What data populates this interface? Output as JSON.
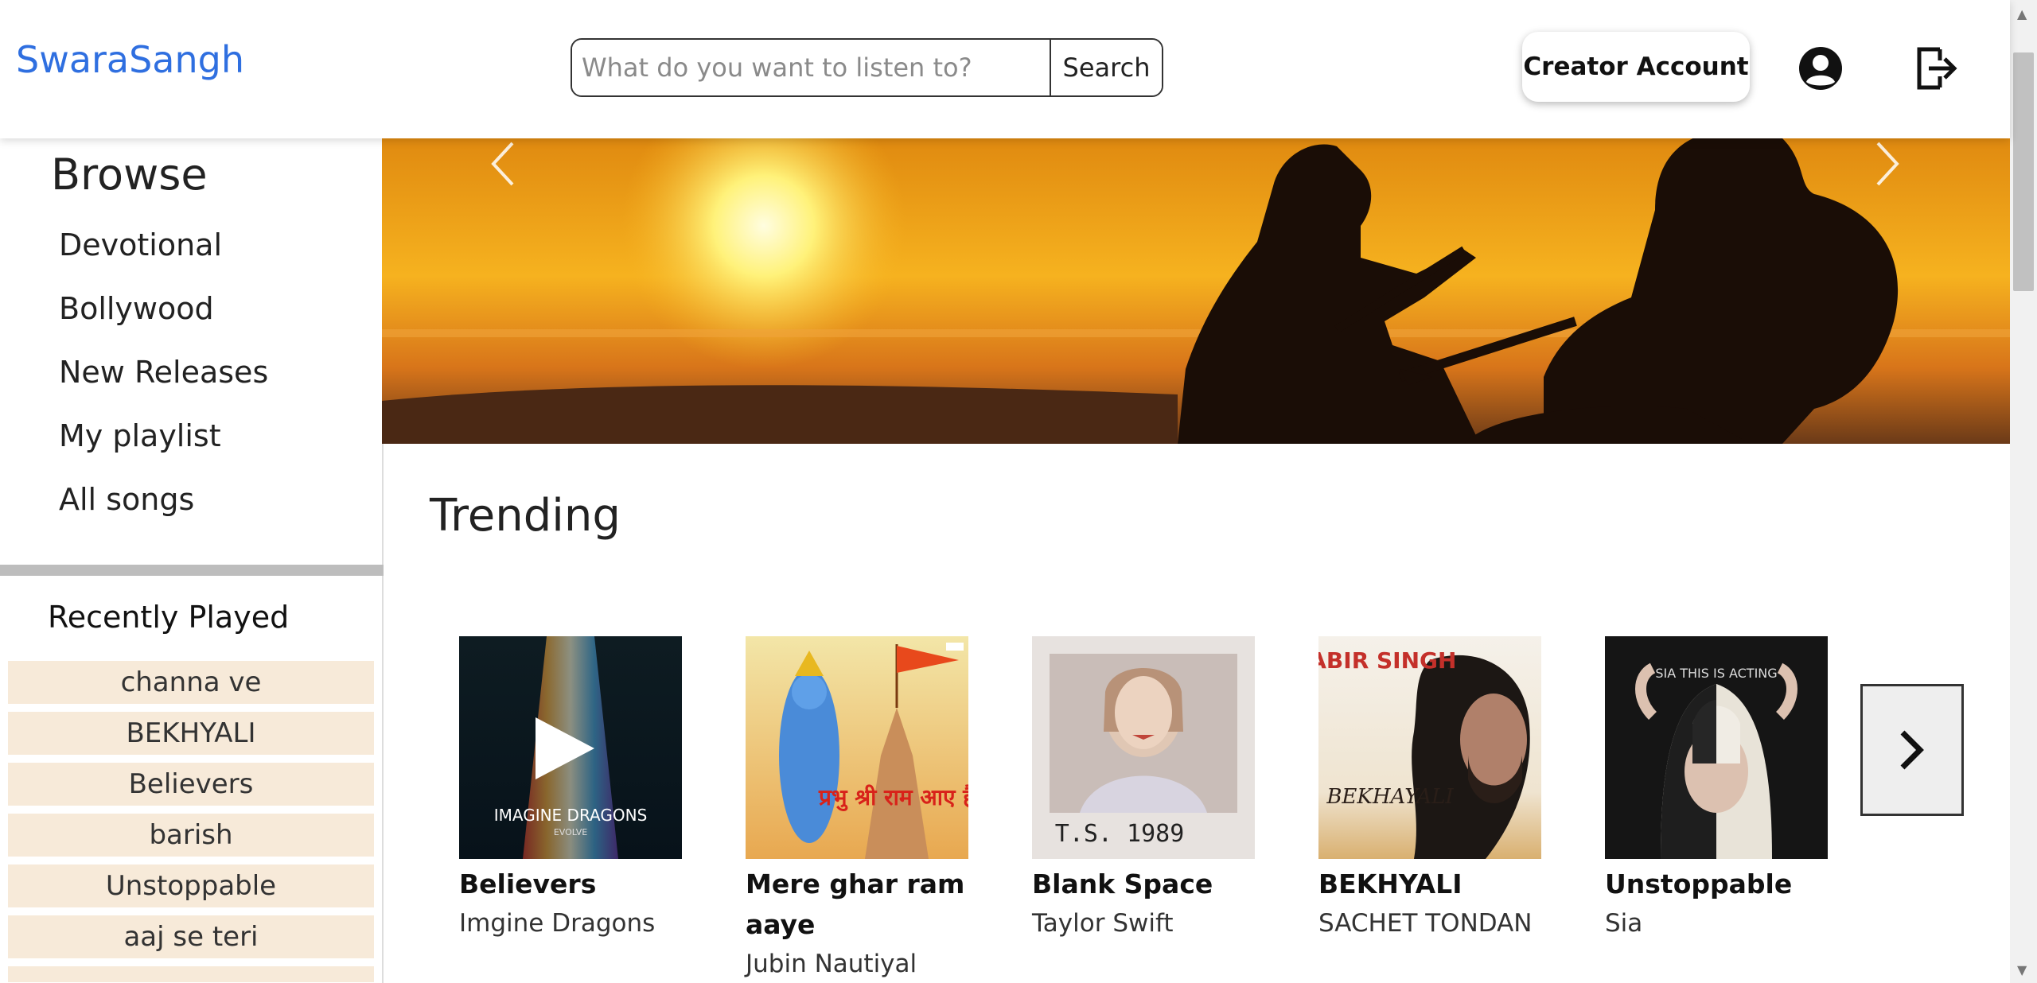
{
  "header": {
    "logo": "SwaraSangh",
    "search_placeholder": "What do you want to listen to?",
    "search_button": "Search",
    "creator_button": "Creator Account"
  },
  "sidebar": {
    "browse_title": "Browse",
    "nav_items": [
      {
        "label": "Devotional"
      },
      {
        "label": "Bollywood"
      },
      {
        "label": "New Releases"
      },
      {
        "label": "My playlist"
      },
      {
        "label": "All songs"
      }
    ],
    "recent_title": "Recently Played",
    "recent_items": [
      "channa ve",
      "BEKHYALI",
      "Believers",
      "barish",
      "Unstoppable",
      "aaj se teri"
    ]
  },
  "main": {
    "trending_title": "Trending",
    "cards": [
      {
        "title": "Believers",
        "artist": "Imgine Dragons",
        "cover_text": "IMAGINE DRAGONS",
        "cover_sub": "EVOLVE"
      },
      {
        "title": "Mere ghar ram aaye",
        "artist": "Jubin Nautiyal",
        "cover_text": "प्रभु श्री राम आए है"
      },
      {
        "title": "Blank Space",
        "artist": "Taylor Swift",
        "cover_text": "T.S.      1989"
      },
      {
        "title": "BEKHYALI",
        "artist": "SACHET TONDAN",
        "cover_text": "KABIR SINGH",
        "cover_sub": "BEKHAYALI"
      },
      {
        "title": "Unstoppable",
        "artist": "Sia",
        "cover_text": "SIA THIS IS ACTING"
      }
    ]
  },
  "colors": {
    "brand": "#2f6fe0",
    "recent_bg": "#f7ead9",
    "divider": "#bdbdbd"
  }
}
